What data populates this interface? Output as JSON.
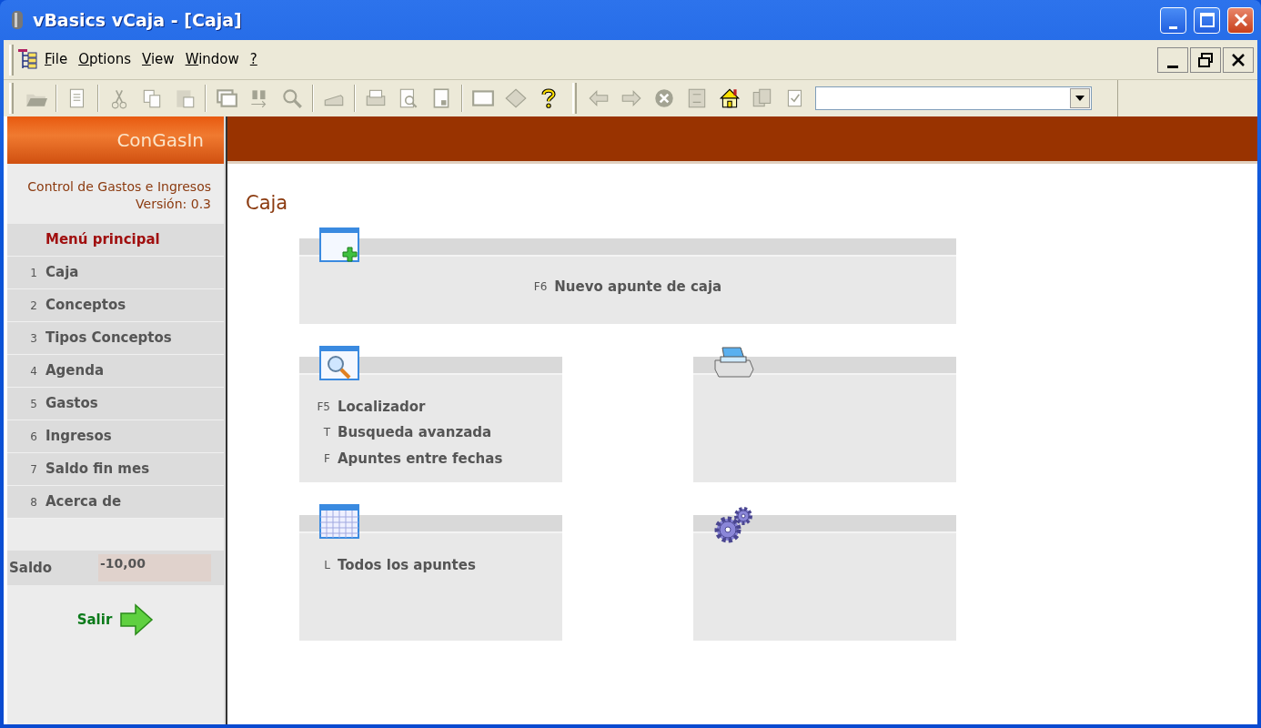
{
  "window": {
    "title": "vBasics vCaja - [Caja]"
  },
  "menu_bar": {
    "items": [
      "File",
      "Options",
      "View",
      "Window",
      "?"
    ]
  },
  "toolbar": {
    "items": [
      {
        "kind": "button",
        "disabled": true
      },
      {
        "kind": "separator"
      },
      {
        "kind": "button",
        "disabled": true
      },
      {
        "kind": "separator"
      },
      {
        "kind": "button",
        "disabled": true
      },
      {
        "kind": "button",
        "disabled": true
      },
      {
        "kind": "button",
        "disabled": true
      },
      {
        "kind": "separator"
      },
      {
        "kind": "button",
        "disabled": true
      },
      {
        "kind": "button",
        "disabled": true
      },
      {
        "kind": "button",
        "disabled": true
      },
      {
        "kind": "separator"
      },
      {
        "kind": "button",
        "disabled": true
      },
      {
        "kind": "separator"
      },
      {
        "kind": "button",
        "disabled": true
      },
      {
        "kind": "button",
        "disabled": true
      },
      {
        "kind": "button",
        "disabled": true
      },
      {
        "kind": "separator"
      },
      {
        "kind": "button",
        "disabled": true
      },
      {
        "kind": "button",
        "disabled": true
      },
      {
        "kind": "button",
        "disabled": false
      },
      {
        "kind": "grip"
      },
      {
        "kind": "button",
        "disabled": true
      },
      {
        "kind": "button",
        "disabled": true
      },
      {
        "kind": "button",
        "disabled": true
      },
      {
        "kind": "button",
        "disabled": true
      },
      {
        "kind": "button",
        "disabled": false
      },
      {
        "kind": "button",
        "disabled": true
      },
      {
        "kind": "button",
        "disabled": true
      },
      {
        "kind": "combo"
      }
    ]
  },
  "sidebar": {
    "app_name": "ConGasIn",
    "description": "Control de Gastos e Ingresos",
    "version": "Versión: 0.3",
    "menu_title": "Menú principal",
    "items": [
      {
        "key": "1",
        "label": "Caja"
      },
      {
        "key": "2",
        "label": "Conceptos"
      },
      {
        "key": "3",
        "label": "Tipos Conceptos"
      },
      {
        "key": "4",
        "label": "Agenda"
      },
      {
        "key": "5",
        "label": "Gastos"
      },
      {
        "key": "6",
        "label": "Ingresos"
      },
      {
        "key": "7",
        "label": "Saldo fin mes"
      },
      {
        "key": "8",
        "label": "Acerca de"
      }
    ],
    "balance_label": "Saldo",
    "balance_value": "-10,00",
    "exit_label": "Salir"
  },
  "content": {
    "title": "Caja",
    "panels": [
      {
        "kind": "new",
        "wide": true,
        "items": [
          {
            "key": "F6",
            "label": "Nuevo apunte de caja"
          }
        ]
      },
      {
        "kind": "search",
        "wide": false,
        "items": [
          {
            "key": "F5",
            "label": "Localizador"
          },
          {
            "key": "T",
            "label": "Busqueda avanzada"
          },
          {
            "key": "F",
            "label": "Apuntes entre fechas"
          }
        ]
      },
      {
        "kind": "print",
        "wide": false
      },
      {
        "kind": "calendar",
        "wide": false,
        "items": [
          {
            "key": "L",
            "label": "Todos los apuntes"
          }
        ]
      },
      {
        "kind": "gears",
        "wide": false
      }
    ]
  }
}
